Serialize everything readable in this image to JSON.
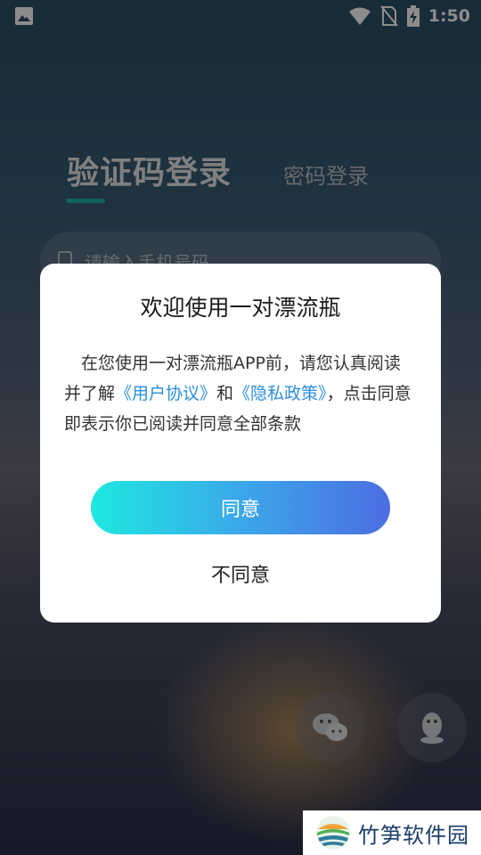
{
  "status_bar": {
    "time": "1:50",
    "icons": [
      "image-notification-icon",
      "wifi-icon",
      "no-sim-icon",
      "battery-charging-icon"
    ]
  },
  "login": {
    "tab_sms": "验证码登录",
    "tab_password": "密码登录",
    "phone_placeholder": "请输入手机号码",
    "social": [
      "wechat-icon",
      "qq-icon"
    ]
  },
  "dialog": {
    "title": "欢迎使用一对漂流瓶",
    "body_part1": "在您使用一对漂流瓶APP前，请您认真阅读并了解",
    "user_agreement": "《用户协议》",
    "and": "和",
    "privacy_policy": "《隐私政策》",
    "body_part2": "，点击同意即表示你已阅读并同意全部条款",
    "agree_label": "同意",
    "disagree_label": "不同意"
  },
  "watermark": {
    "text": "竹笋软件园"
  },
  "colors": {
    "accent_tab": "#1fb2a5",
    "link": "#2b8fe0",
    "button_gradient_start": "#1ee8e0",
    "button_gradient_end": "#4c6de2"
  }
}
